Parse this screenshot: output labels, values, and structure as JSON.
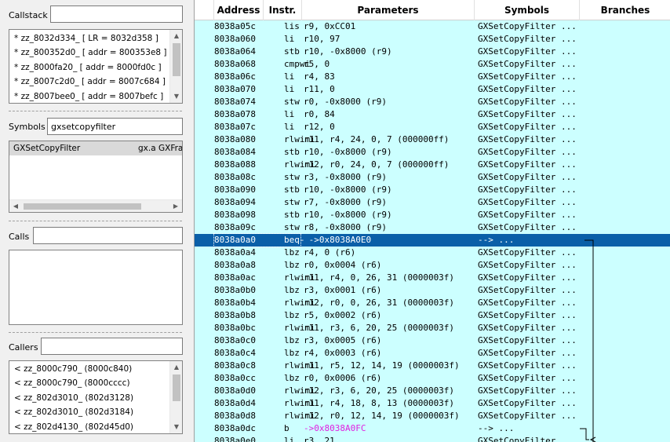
{
  "callstack": {
    "label": "Callstack",
    "input_value": "",
    "items": [
      "* zz_8032d334_ [ LR = 8032d358 ]",
      "* zz_800352d0_ [ addr = 800353e8 ]",
      "* zz_8000fa20_ [ addr = 8000fd0c ]",
      "* zz_8007c2d0_ [ addr = 8007c684 ]",
      "* zz_8007bee0_ [ addr = 8007befc ]"
    ]
  },
  "symbols": {
    "label": "Symbols",
    "input_value": "gxsetcopyfilter",
    "items": [
      {
        "name": "GXSetCopyFilter",
        "file": "gx.a GXFra"
      }
    ]
  },
  "calls": {
    "label": "Calls",
    "input_value": ""
  },
  "callers": {
    "label": "Callers",
    "input_value": "",
    "items": [
      "< zz_8000c790_ (8000c840)",
      "< zz_8000c790_ (8000cccc)",
      "< zz_802d3010_ (802d3128)",
      "< zz_802d3010_ (802d3184)",
      "< zz_802d4130_ (802d45d0)"
    ]
  },
  "disassembly": {
    "columns": [
      "Address",
      "Instr.",
      "Parameters",
      "Symbols",
      "Branches"
    ],
    "rows": [
      {
        "addr": "8038a05c",
        "ins": "lis",
        "par": "r9, 0xCC01",
        "sym": "GXSetCopyFilter ..."
      },
      {
        "addr": "8038a060",
        "ins": "li",
        "par": "r10, 97",
        "sym": "GXSetCopyFilter ..."
      },
      {
        "addr": "8038a064",
        "ins": "stb",
        "par": "r10, -0x8000 (r9)",
        "sym": "GXSetCopyFilter ..."
      },
      {
        "addr": "8038a068",
        "ins": "cmpwi",
        "par": "r5, 0",
        "sym": "GXSetCopyFilter ..."
      },
      {
        "addr": "8038a06c",
        "ins": "li",
        "par": "r4, 83",
        "sym": "GXSetCopyFilter ..."
      },
      {
        "addr": "8038a070",
        "ins": "li",
        "par": "r11, 0",
        "sym": "GXSetCopyFilter ..."
      },
      {
        "addr": "8038a074",
        "ins": "stw",
        "par": "r0, -0x8000 (r9)",
        "sym": "GXSetCopyFilter ..."
      },
      {
        "addr": "8038a078",
        "ins": "li",
        "par": "r0, 84",
        "sym": "GXSetCopyFilter ..."
      },
      {
        "addr": "8038a07c",
        "ins": "li",
        "par": "r12, 0",
        "sym": "GXSetCopyFilter ..."
      },
      {
        "addr": "8038a080",
        "ins": "rlwimi",
        "par": "r11, r4, 24, 0, 7 (000000ff)",
        "sym": "GXSetCopyFilter ..."
      },
      {
        "addr": "8038a084",
        "ins": "stb",
        "par": "r10, -0x8000 (r9)",
        "sym": "GXSetCopyFilter ..."
      },
      {
        "addr": "8038a088",
        "ins": "rlwimi",
        "par": "r12, r0, 24, 0, 7 (000000ff)",
        "sym": "GXSetCopyFilter ..."
      },
      {
        "addr": "8038a08c",
        "ins": "stw",
        "par": "r3, -0x8000 (r9)",
        "sym": "GXSetCopyFilter ..."
      },
      {
        "addr": "8038a090",
        "ins": "stb",
        "par": "r10, -0x8000 (r9)",
        "sym": "GXSetCopyFilter ..."
      },
      {
        "addr": "8038a094",
        "ins": "stw",
        "par": "r7, -0x8000 (r9)",
        "sym": "GXSetCopyFilter ..."
      },
      {
        "addr": "8038a098",
        "ins": "stb",
        "par": "r10, -0x8000 (r9)",
        "sym": "GXSetCopyFilter ..."
      },
      {
        "addr": "8038a09c",
        "ins": "stw",
        "par": "r8, -0x8000 (r9)",
        "sym": "GXSetCopyFilter ..."
      },
      {
        "addr": "8038a0a0",
        "ins": "beq-",
        "par": " ->0x8038A0E0",
        "sym": "--> ...",
        "selected": true
      },
      {
        "addr": "8038a0a4",
        "ins": "lbz",
        "par": "r4, 0 (r6)",
        "sym": "GXSetCopyFilter ..."
      },
      {
        "addr": "8038a0a8",
        "ins": "lbz",
        "par": "r0, 0x0004 (r6)",
        "sym": "GXSetCopyFilter ..."
      },
      {
        "addr": "8038a0ac",
        "ins": "rlwimi",
        "par": "r11, r4, 0, 26, 31 (0000003f)",
        "sym": "GXSetCopyFilter ..."
      },
      {
        "addr": "8038a0b0",
        "ins": "lbz",
        "par": "r3, 0x0001 (r6)",
        "sym": "GXSetCopyFilter ..."
      },
      {
        "addr": "8038a0b4",
        "ins": "rlwimi",
        "par": "r12, r0, 0, 26, 31 (0000003f)",
        "sym": "GXSetCopyFilter ..."
      },
      {
        "addr": "8038a0b8",
        "ins": "lbz",
        "par": "r5, 0x0002 (r6)",
        "sym": "GXSetCopyFilter ..."
      },
      {
        "addr": "8038a0bc",
        "ins": "rlwimi",
        "par": "r11, r3, 6, 20, 25 (0000003f)",
        "sym": "GXSetCopyFilter ..."
      },
      {
        "addr": "8038a0c0",
        "ins": "lbz",
        "par": "r3, 0x0005 (r6)",
        "sym": "GXSetCopyFilter ..."
      },
      {
        "addr": "8038a0c4",
        "ins": "lbz",
        "par": "r4, 0x0003 (r6)",
        "sym": "GXSetCopyFilter ..."
      },
      {
        "addr": "8038a0c8",
        "ins": "rlwimi",
        "par": "r11, r5, 12, 14, 19 (0000003f)",
        "sym": "GXSetCopyFilter ..."
      },
      {
        "addr": "8038a0cc",
        "ins": "lbz",
        "par": "r0, 0x0006 (r6)",
        "sym": "GXSetCopyFilter ..."
      },
      {
        "addr": "8038a0d0",
        "ins": "rlwimi",
        "par": "r12, r3, 6, 20, 25 (0000003f)",
        "sym": "GXSetCopyFilter ..."
      },
      {
        "addr": "8038a0d4",
        "ins": "rlwimi",
        "par": "r11, r4, 18, 8, 13 (0000003f)",
        "sym": "GXSetCopyFilter ..."
      },
      {
        "addr": "8038a0d8",
        "ins": "rlwimi",
        "par": "r12, r0, 12, 14, 19 (0000003f)",
        "sym": "GXSetCopyFilter ..."
      },
      {
        "addr": "8038a0dc",
        "ins": "b",
        "par": "->0x8038A0FC",
        "sym": "--> ...",
        "par_color": "#e020e0"
      },
      {
        "addr": "8038a0e0",
        "ins": "li",
        "par": "r3, 21",
        "sym": "GXSetCopyFilter ..."
      }
    ]
  }
}
